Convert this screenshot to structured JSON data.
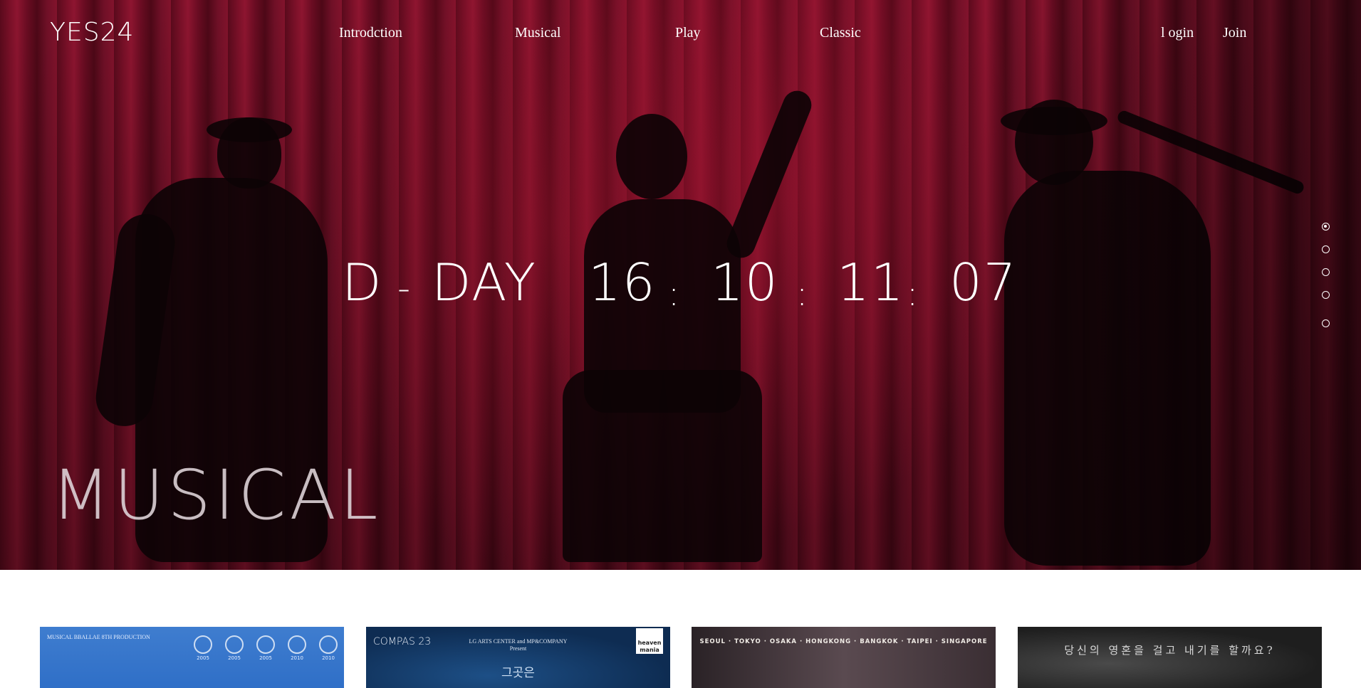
{
  "header": {
    "logo": "YES24",
    "nav": [
      "Introdction",
      "Musical",
      "Play",
      "Classic"
    ],
    "login": "l ogin",
    "join": "Join"
  },
  "hero": {
    "countdown": {
      "label": "D",
      "dash": "-",
      "label_word": "DAY",
      "days": "16",
      "hours": "10",
      "minutes": "11",
      "seconds": "07",
      "separator": ":"
    },
    "section_title": "MUSICAL",
    "pager": {
      "count": 5,
      "active_index": 0
    }
  },
  "posters": [
    {
      "top_text": "MUSICAL BBALLAE 8TH PRODUCTION",
      "awards": [
        "2005",
        "2005",
        "2005",
        "2010",
        "2010"
      ]
    },
    {
      "logo": "COMPAS 23",
      "presenter": "LG ARTS CENTER and MP&COMPANY",
      "presents": "Present",
      "title_kr": "그곳은",
      "badge": "heaven mania"
    },
    {
      "cities": "SEOUL · TOKYO · OSAKA · HONGKONG · BANGKOK · TAIPEI · SINGAPORE"
    },
    {
      "text_kr": "당신의 영혼을 걸고 내기를 할까요?"
    }
  ]
}
